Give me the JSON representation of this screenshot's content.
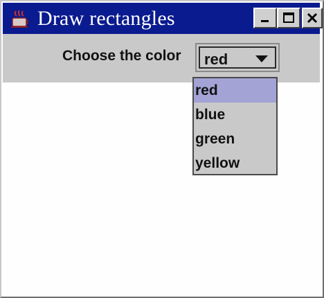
{
  "window": {
    "title": "Draw rectangles",
    "app_icon": "java-cup-icon",
    "controls": [
      "minimize-icon",
      "maximize-icon",
      "close-icon"
    ]
  },
  "toolbar": {
    "label": "Choose the color",
    "combo": {
      "value": "red",
      "options": [
        "red",
        "blue",
        "green",
        "yellow"
      ],
      "selected_index": 0
    }
  },
  "colors": {
    "titlebar": "#0a1a8f",
    "panel": "#c9c9c9",
    "selection": "#a3a3d6"
  }
}
